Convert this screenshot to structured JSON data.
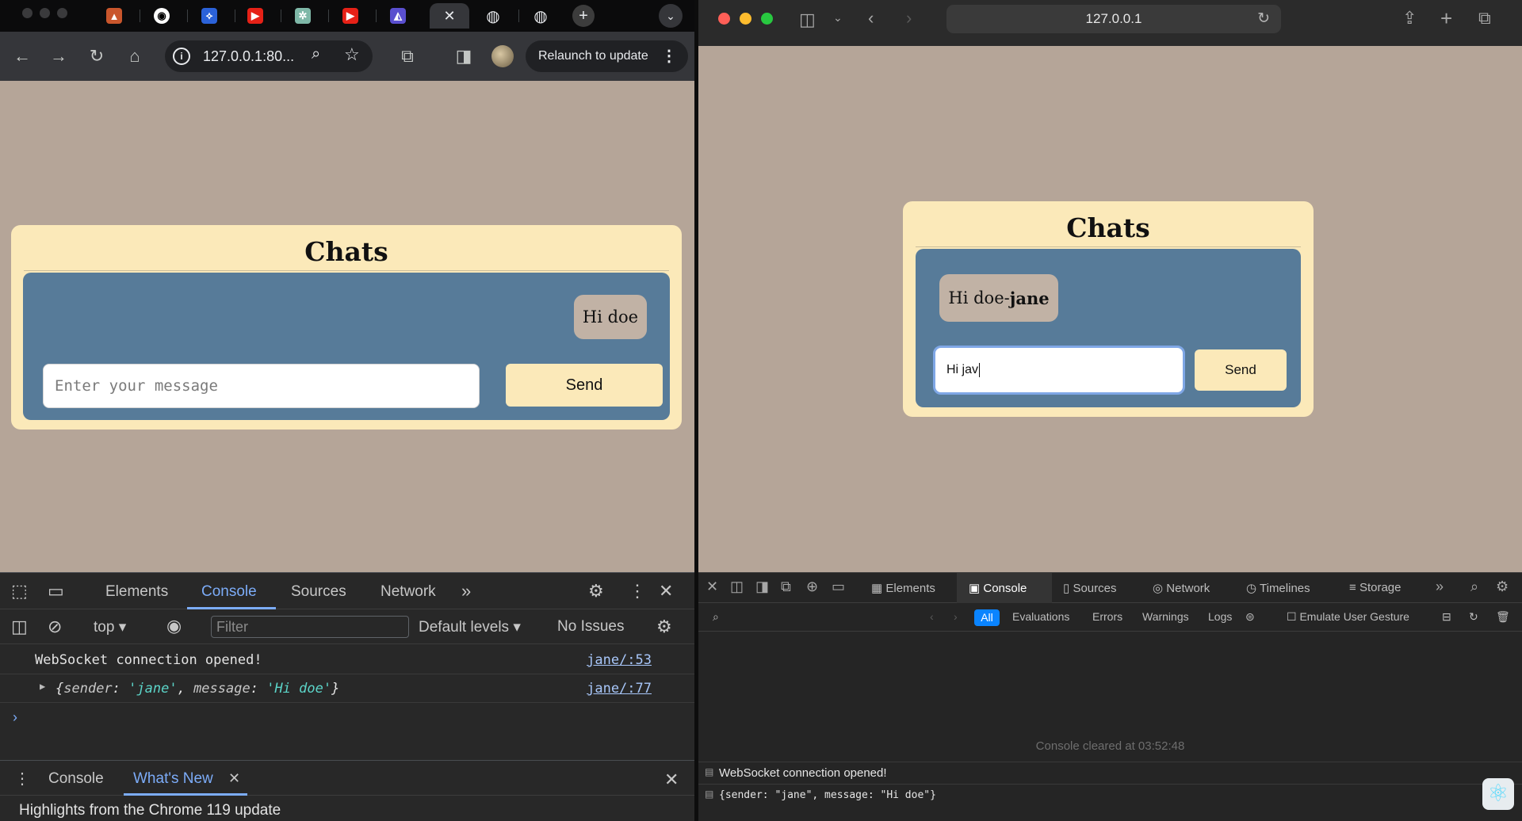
{
  "colors": {
    "page_bg": "#b5a598",
    "card_bg": "#fbe9b9",
    "chat_area_bg": "#577b99",
    "bubble_bg": "#c1b2a5",
    "devtools_accent": "#7cacf8",
    "safari_all_filter": "#0a84ff"
  },
  "chrome": {
    "tabs": [
      {
        "icon": "generic-tab-icon"
      },
      {
        "icon": "github-icon"
      },
      {
        "icon": "tab-icon-blue"
      },
      {
        "icon": "youtube-icon"
      },
      {
        "icon": "chatgpt-icon"
      },
      {
        "icon": "youtube-icon"
      },
      {
        "icon": "tab-icon-purple"
      },
      {
        "icon": "close-icon",
        "active": true
      },
      {
        "icon": "globe-icon"
      },
      {
        "icon": "globe-icon"
      }
    ],
    "address": "127.0.0.1:80...",
    "relaunch_label": "Relaunch to update",
    "page": {
      "title": "Chats",
      "bubble": "Hi doe",
      "input_placeholder": "Enter your message",
      "send_label": "Send"
    },
    "devtools": {
      "tabs": [
        "Elements",
        "Console",
        "Sources",
        "Network"
      ],
      "active_tab": "Console",
      "context": "top",
      "filter_placeholder": "Filter",
      "levels": "Default levels ▾",
      "issues": "No Issues",
      "console": [
        {
          "text": "WebSocket connection opened!",
          "source": "jane/:53"
        },
        {
          "sender_key": "sender",
          "sender_val": "'jane'",
          "msg_key": "message",
          "msg_val": "'Hi doe'",
          "source": "jane/:77"
        }
      ],
      "drawer": {
        "tabs": [
          "Console",
          "What's New"
        ],
        "active_tab": "What's New",
        "headline": "Highlights from the Chrome 119 update"
      }
    }
  },
  "safari": {
    "address": "127.0.0.1",
    "page": {
      "title": "Chats",
      "bubble_text": "Hi doe-",
      "bubble_sender": "jane",
      "input_value": "Hi jav",
      "send_label": "Send"
    },
    "devtools": {
      "tabs": [
        "Elements",
        "Console",
        "Sources",
        "Network",
        "Timelines",
        "Storage"
      ],
      "active_tab": "Console",
      "filters": [
        "All",
        "Evaluations",
        "Errors",
        "Warnings",
        "Logs"
      ],
      "emulate": "Emulate User Gesture",
      "cleared": "Console cleared at 03:52:48",
      "console": [
        {
          "text": "WebSocket connection opened!"
        },
        {
          "text": "{sender: \"jane\", message: \"Hi doe\"}"
        }
      ]
    }
  }
}
